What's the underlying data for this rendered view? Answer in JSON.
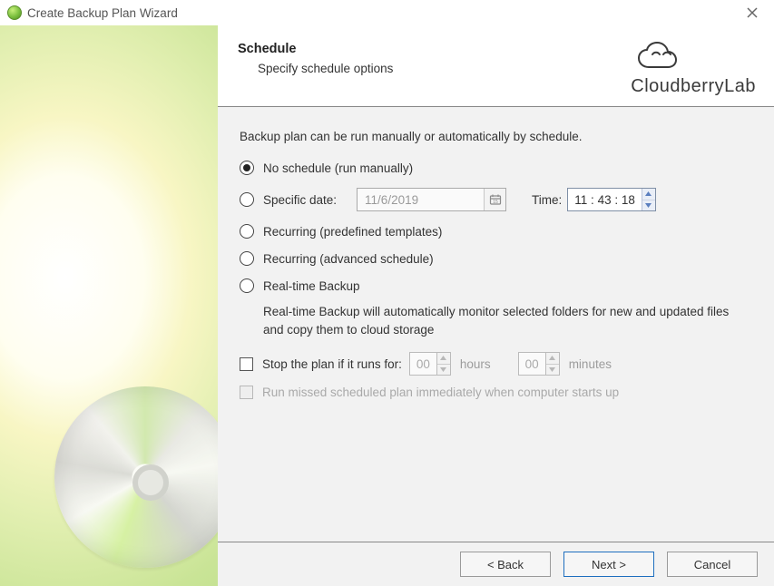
{
  "window": {
    "title": "Create Backup Plan Wizard"
  },
  "brand": "CloudberryLab",
  "header": {
    "title": "Schedule",
    "subtitle": "Specify schedule options"
  },
  "intro": "Backup plan can be run manually or automatically by schedule.",
  "options": {
    "no_schedule": "No schedule (run manually)",
    "specific_date": "Specific date:",
    "recurring_predefined": "Recurring (predefined templates)",
    "recurring_advanced": "Recurring (advanced schedule)",
    "realtime": "Real-time Backup"
  },
  "date": {
    "value": "11/6/2019",
    "time_label": "Time:",
    "time_value": "11 : 43 : 18"
  },
  "realtime_desc": "Real-time Backup will automatically monitor selected folders for new and updated files and copy them to cloud storage",
  "stop": {
    "label": "Stop the plan if it runs for:",
    "hours_value": "00",
    "hours_unit": "hours",
    "minutes_value": "00",
    "minutes_unit": "minutes"
  },
  "run_missed": "Run missed scheduled plan immediately when computer starts up",
  "buttons": {
    "back": "< Back",
    "next": "Next >",
    "cancel": "Cancel"
  }
}
